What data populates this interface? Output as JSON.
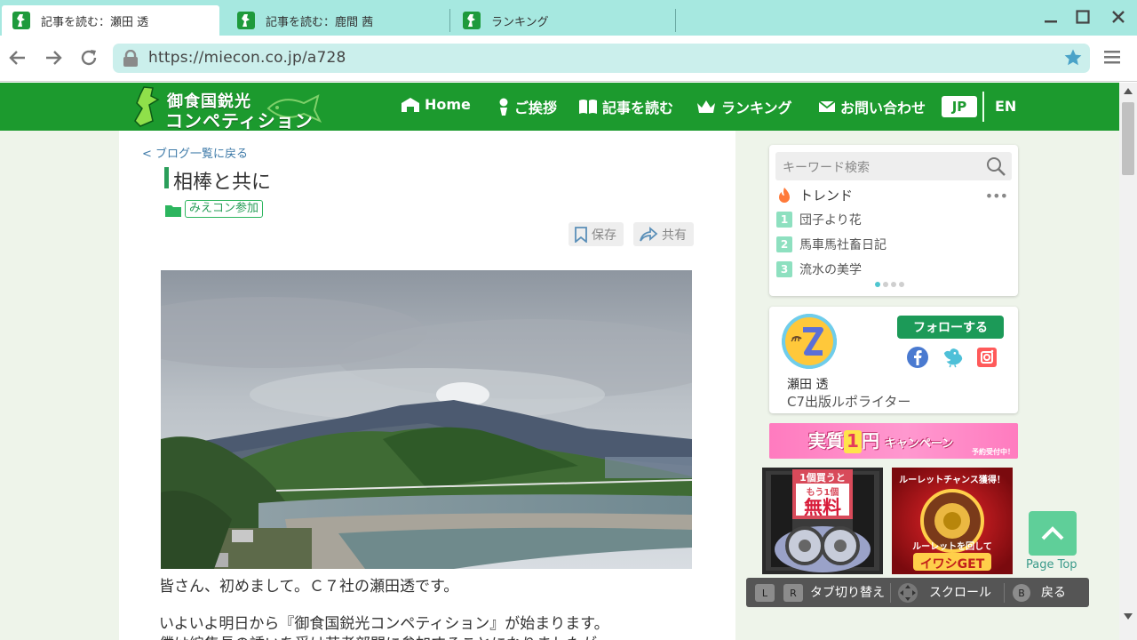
{
  "browser": {
    "tabs": [
      {
        "title": "記事を読む：瀬田 透",
        "active": true
      },
      {
        "title": "記事を読む：鹿間 茜",
        "active": false
      },
      {
        "title": "ランキング",
        "active": false
      }
    ],
    "url": "https://miecon.co.jp/a728"
  },
  "header": {
    "logo_title": "御食国鋭光",
    "logo_sub": "コンペティション",
    "nav": {
      "home": "Home",
      "greeting": "ご挨拶",
      "articles": "記事を読む",
      "ranking": "ランキング",
      "contact": "お問い合わせ"
    },
    "lang_jp": "JP",
    "lang_en": "EN"
  },
  "article": {
    "back_link": "<  ブログ一覧に戻る",
    "title": "相棒と共に",
    "category": "みえコン参加",
    "save_label": "保存",
    "share_label": "共有",
    "paragraphs": [
      "皆さん、初めまして。Ｃ７社の瀬田透です。",
      "いよいよ明日から『御食国鋭光コンペティション』が始まります。",
      "僕は編集長の誘いを受け若者部門に参加することになりましたが"
    ]
  },
  "sidebar": {
    "search_placeholder": "キーワード検索",
    "trend_label": "トレンド",
    "trends": [
      {
        "rank": "1",
        "title": "団子より花"
      },
      {
        "rank": "2",
        "title": "馬車馬社畜日記"
      },
      {
        "rank": "3",
        "title": "流水の美学"
      }
    ],
    "author": {
      "follow_label": "フォローする",
      "name": "瀬田 透",
      "role": "C7出版ルポライター"
    },
    "banner": {
      "prefix": "実質",
      "one": "1",
      "suffix": "円",
      "campaign": "キャンペーン",
      "sub": "予約受付中！"
    },
    "ad1": {
      "top": "1個買うと",
      "mid": "もう1個",
      "big": "無料"
    },
    "ad2": {
      "top": "ルーレットチャンス獲得！",
      "mid": "ルーレットを回して",
      "big": "イワシGET"
    }
  },
  "page_top": "Page Top",
  "controls": {
    "key_l": "L",
    "key_r": "R",
    "tab_switch": "タブ切り替え",
    "scroll": "スクロール",
    "key_b": "B",
    "back": "戻る"
  },
  "colors": {
    "site_green": "#1c9a2e",
    "tab_bar": "#a6e8e0",
    "url_box": "#cbefec",
    "accent_teal": "#2a9e5a"
  }
}
